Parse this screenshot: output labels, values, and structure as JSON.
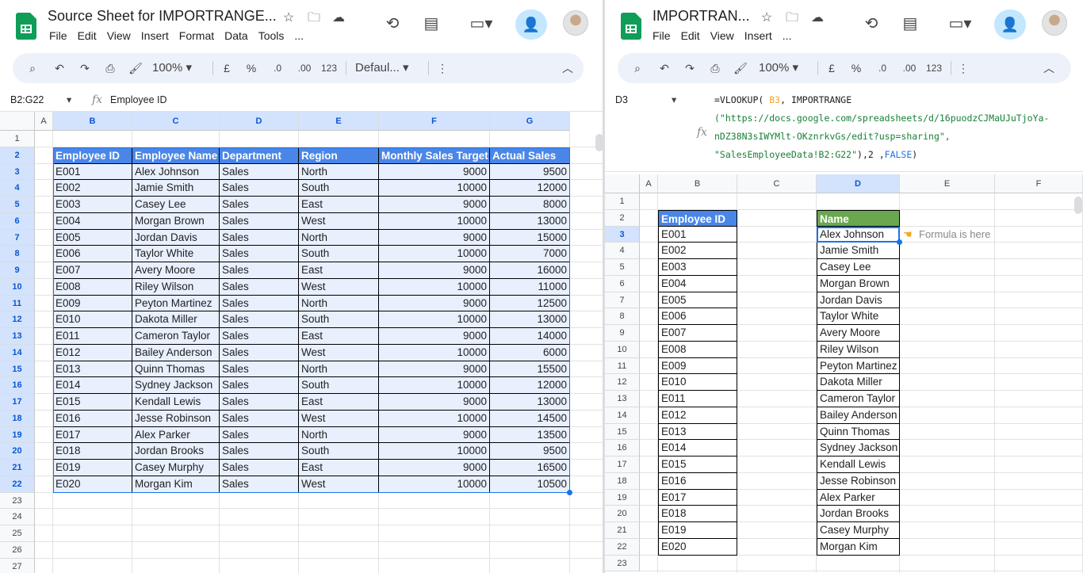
{
  "left": {
    "doc_title": "Source Sheet for IMPORTRANGE...",
    "menus": [
      "File",
      "Edit",
      "View",
      "Insert",
      "Format",
      "Data",
      "Tools",
      "..."
    ],
    "toolbar": {
      "zoom": "100%",
      "currency": "£",
      "percent": "%",
      "dec_minus": ".0",
      "dec_plus": ".00",
      "num_format": "123",
      "font": "Defaul..."
    },
    "name_box": "B2:G22",
    "formula": "Employee ID",
    "columns": [
      "A",
      "B",
      "C",
      "D",
      "E",
      "F",
      "G"
    ],
    "rows": [
      "1",
      "2",
      "3",
      "4",
      "5",
      "6",
      "7",
      "8",
      "9",
      "10",
      "11",
      "12",
      "13",
      "14",
      "15",
      "16",
      "17",
      "18",
      "19",
      "20",
      "21",
      "22",
      "23",
      "24",
      "25",
      "26",
      "27"
    ],
    "table_header": [
      "Employee ID",
      "Employee Name",
      "Department",
      "Region",
      "Monthly Sales Target",
      "Actual Sales"
    ],
    "table_rows": [
      [
        "E001",
        "Alex Johnson",
        "Sales",
        "North",
        "9000",
        "9500"
      ],
      [
        "E002",
        "Jamie Smith",
        "Sales",
        "South",
        "10000",
        "12000"
      ],
      [
        "E003",
        "Casey Lee",
        "Sales",
        "East",
        "9000",
        "8000"
      ],
      [
        "E004",
        "Morgan Brown",
        "Sales",
        "West",
        "10000",
        "13000"
      ],
      [
        "E005",
        "Jordan Davis",
        "Sales",
        "North",
        "9000",
        "15000"
      ],
      [
        "E006",
        "Taylor White",
        "Sales",
        "South",
        "10000",
        "7000"
      ],
      [
        "E007",
        "Avery Moore",
        "Sales",
        "East",
        "9000",
        "16000"
      ],
      [
        "E008",
        "Riley Wilson",
        "Sales",
        "West",
        "10000",
        "11000"
      ],
      [
        "E009",
        "Peyton Martinez",
        "Sales",
        "North",
        "9000",
        "12500"
      ],
      [
        "E010",
        "Dakota Miller",
        "Sales",
        "South",
        "10000",
        "13000"
      ],
      [
        "E011",
        "Cameron Taylor",
        "Sales",
        "East",
        "9000",
        "14000"
      ],
      [
        "E012",
        "Bailey Anderson",
        "Sales",
        "West",
        "10000",
        "6000"
      ],
      [
        "E013",
        "Quinn Thomas",
        "Sales",
        "North",
        "9000",
        "15500"
      ],
      [
        "E014",
        "Sydney Jackson",
        "Sales",
        "South",
        "10000",
        "12000"
      ],
      [
        "E015",
        "Kendall Lewis",
        "Sales",
        "East",
        "9000",
        "13000"
      ],
      [
        "E016",
        "Jesse Robinson",
        "Sales",
        "West",
        "10000",
        "14500"
      ],
      [
        "E017",
        "Alex Parker",
        "Sales",
        "North",
        "9000",
        "13500"
      ],
      [
        "E018",
        "Jordan Brooks",
        "Sales",
        "South",
        "10000",
        "9500"
      ],
      [
        "E019",
        "Casey Murphy",
        "Sales",
        "East",
        "9000",
        "16500"
      ],
      [
        "E020",
        "Morgan Kim",
        "Sales",
        "West",
        "10000",
        "10500"
      ]
    ]
  },
  "right": {
    "doc_title": "IMPORTRAN...",
    "menus": [
      "File",
      "Edit",
      "View",
      "Insert",
      "..."
    ],
    "toolbar": {
      "zoom": "100%",
      "currency": "£",
      "percent": "%",
      "dec_minus": ".0",
      "dec_plus": ".00",
      "num_format": "123"
    },
    "name_box": "D3",
    "formula_parts": {
      "p1": "=VLOOKUP( ",
      "ref": "B3",
      "p2": ", IMPORTRANGE",
      "url1": "(\"https://docs.google.com/spreadsheets/d/16puodzCJMaUJuTjoYa-",
      "url2": "nDZ38N3sIWYMlt-OKznrkvGs/edit?usp=sharing\",",
      "range": "\"SalesEmployeeData!B2:G22\"",
      "p3": "),2 ,",
      "kw": "FALSE",
      "p4": ")"
    },
    "columns": [
      "A",
      "B",
      "C",
      "D",
      "E",
      "F"
    ],
    "rows": [
      "1",
      "2",
      "3",
      "4",
      "5",
      "6",
      "7",
      "8",
      "9",
      "10",
      "11",
      "12",
      "13",
      "14",
      "15",
      "16",
      "17",
      "18",
      "19",
      "20",
      "21",
      "22",
      "23"
    ],
    "id_header": "Employee ID",
    "name_header": "Name",
    "ids": [
      "E001",
      "E002",
      "E003",
      "E004",
      "E005",
      "E006",
      "E007",
      "E008",
      "E009",
      "E010",
      "E011",
      "E012",
      "E013",
      "E014",
      "E015",
      "E016",
      "E017",
      "E018",
      "E019",
      "E020"
    ],
    "names": [
      "Alex Johnson",
      "Jamie Smith",
      "Casey Lee",
      "Morgan Brown",
      "Jordan Davis",
      "Taylor White",
      "Avery Moore",
      "Riley Wilson",
      "Peyton Martinez",
      "Dakota Miller",
      "Cameron Taylor",
      "Bailey Anderson",
      "Quinn Thomas",
      "Sydney Jackson",
      "Kendall Lewis",
      "Jesse Robinson",
      "Alex Parker",
      "Jordan Brooks",
      "Casey Murphy",
      "Morgan Kim"
    ],
    "note": "Formula is here"
  },
  "colors": {
    "header_blue": "#4a86e8",
    "header_green": "#6aa84f",
    "selection": "#e8f0fe",
    "share": "#c2e7ff"
  }
}
